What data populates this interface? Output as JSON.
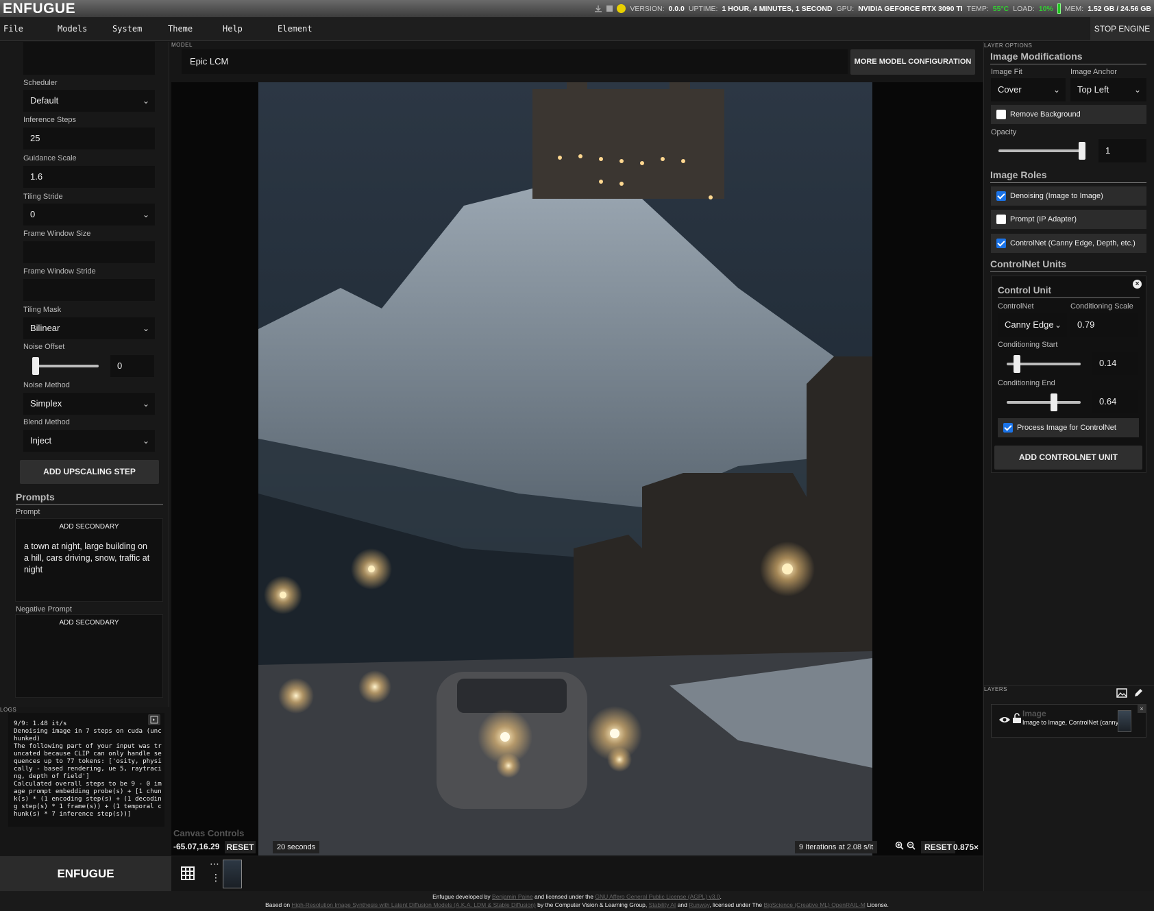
{
  "header": {
    "logo": "ENFUGUE",
    "version_label": "VERSION:",
    "version": "0.0.0",
    "uptime_label": "UPTIME:",
    "uptime": "1 HOUR, 4 MINUTES, 1 SECOND",
    "gpu_label": "GPU:",
    "gpu": "NVIDIA GEFORCE RTX 3090 TI",
    "temp_label": "TEMP:",
    "temp": "55°C",
    "load_label": "LOAD:",
    "load": "10%",
    "mem_label": "MEM:",
    "mem": "1.52 GB / 24.56 GB",
    "status_color": "#e8d000"
  },
  "menu": {
    "items": [
      "File",
      "Models",
      "System",
      "Theme",
      "Help",
      "Element"
    ],
    "stop_engine": "STOP ENGINE"
  },
  "left": {
    "scheduler_label": "Scheduler",
    "scheduler_value": "Default",
    "inference_steps_label": "Inference Steps",
    "inference_steps_value": "25",
    "guidance_scale_label": "Guidance Scale",
    "guidance_scale_value": "1.6",
    "tiling_stride_label": "Tiling Stride",
    "tiling_stride_value": "0",
    "frame_window_size_label": "Frame Window Size",
    "frame_window_stride_label": "Frame Window Stride",
    "tiling_mask_label": "Tiling Mask",
    "tiling_mask_value": "Bilinear",
    "noise_offset_label": "Noise Offset",
    "noise_offset_value": "0",
    "noise_offset_level": 0,
    "noise_method_label": "Noise Method",
    "noise_method_value": "Simplex",
    "blend_method_label": "Blend Method",
    "blend_method_value": "Inject",
    "add_upscaling_step": "ADD UPSCALING STEP",
    "prompts_header": "Prompts",
    "prompt_label": "Prompt",
    "add_secondary": "ADD SECONDARY",
    "prompt_text": "a town at night, large building on a hill, cars driving, snow, traffic at night",
    "negative_prompt_label": "Negative Prompt",
    "negative_add_secondary": "ADD SECONDARY"
  },
  "logs": {
    "title": "LOGS",
    "text": "9/9: 1.48 it/s\nDenoising image in 7 steps on cuda (unchunked)\nThe following part of your input was truncated because CLIP can only handle sequences up to 77 tokens: ['osity, physically - based rendering, ue 5, raytracing, depth of field']\nCalculated overall steps to be 9 - 0 image prompt embedding probe(s) + [1 chunk(s) * (1 encoding step(s) + (1 decoding step(s) * 1 frame(s)) + (1 temporal chunk(s) * 7 inference step(s))]"
  },
  "model": {
    "label": "MODEL",
    "value": "Epic LCM",
    "config_button": "MORE MODEL CONFIGURATION"
  },
  "canvas": {
    "controls_label": "Canvas Controls",
    "coords": "-65.07,16.29",
    "reset": "RESET",
    "elapsed": "20 seconds",
    "iterations": "9 Iterations at 2.08 s/it",
    "zoom_reset": "RESET",
    "zoom": "0.875×"
  },
  "bottom": {
    "enfugue_button": "ENFUGUE"
  },
  "right": {
    "layer_options_label": "LAYER OPTIONS",
    "image_modifications": "Image Modifications",
    "image_fit_label": "Image Fit",
    "image_fit_value": "Cover",
    "image_anchor_label": "Image Anchor",
    "image_anchor_value": "Top Left",
    "remove_background": "Remove Background",
    "opacity_label": "Opacity",
    "opacity_value": "1",
    "opacity_level": 1,
    "image_roles": "Image Roles",
    "role_denoising": "Denoising (Image to Image)",
    "role_prompt": "Prompt (IP Adapter)",
    "role_controlnet": "ControlNet (Canny Edge, Depth, etc.)",
    "controlnet_units": "ControlNet Units",
    "control_unit_title": "Control Unit",
    "controlnet_label": "ControlNet",
    "controlnet_value": "Canny Edge",
    "conditioning_scale_label": "Conditioning Scale",
    "conditioning_scale_value": "0.79",
    "conditioning_start_label": "Conditioning Start",
    "conditioning_start_value": "0.14",
    "conditioning_start_level": 0.14,
    "conditioning_end_label": "Conditioning End",
    "conditioning_end_value": "0.64",
    "conditioning_end_level": 0.64,
    "process_image": "Process Image for ControlNet",
    "add_controlnet_unit": "ADD CONTROLNET UNIT"
  },
  "layers": {
    "label": "LAYERS",
    "layer_title": "Image",
    "layer_subtitle": "Image to Image, ControlNet (canny)"
  },
  "footer": {
    "line1_pre": "Enfugue developed by ",
    "author": "Benjamin Paine",
    "line1_mid": " and licensed under the ",
    "license": "GNU Affero General Public License (AGPL) v3.0",
    "line1_end": ".",
    "line2_pre": "Based on ",
    "paper": "High-Resolution Image Synthesis with Latent Diffusion Models (A.K.A. LDM & Stable Diffusion)",
    "line2_mid": " by the Computer Vision & Learning Group, ",
    "stability": "Stability AI",
    "and": " and ",
    "runway": "Runway",
    "line2_mid2": ", licensed under The ",
    "openrail": "BigScience (Creative ML) OpenRAIL-M",
    "line2_end": " License."
  }
}
